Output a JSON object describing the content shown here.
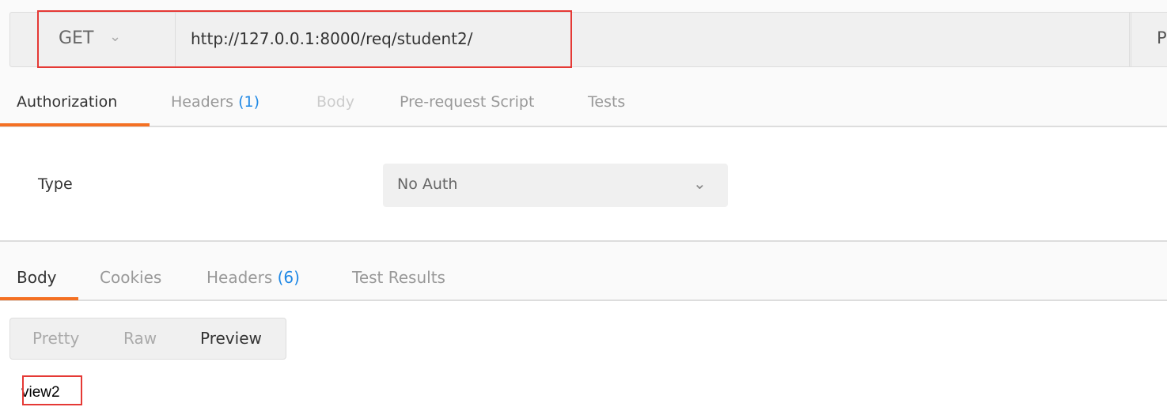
{
  "request": {
    "method": "GET",
    "url": "http://127.0.0.1:8000/req/student2/",
    "params_label": "P"
  },
  "request_tabs": [
    {
      "label": "Authorization"
    },
    {
      "label": "Headers",
      "count": "(1)"
    },
    {
      "label": "Body"
    },
    {
      "label": "Pre-request Script"
    },
    {
      "label": "Tests"
    }
  ],
  "auth": {
    "type_label": "Type",
    "type_value": "No Auth"
  },
  "response_tabs": [
    {
      "label": "Body"
    },
    {
      "label": "Cookies"
    },
    {
      "label": "Headers",
      "count": "(6)"
    },
    {
      "label": "Test Results"
    }
  ],
  "view_modes": [
    "Pretty",
    "Raw",
    "Preview"
  ],
  "response_body": "view2",
  "colors": {
    "accent": "#f47023",
    "count": "#1e88e5",
    "highlight": "#e53935"
  }
}
